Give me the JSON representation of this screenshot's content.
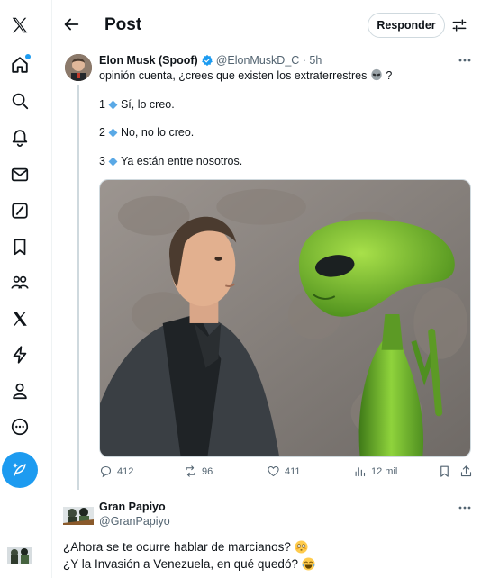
{
  "header": {
    "title": "Post",
    "reply_button": "Responder"
  },
  "nav": {
    "items": [
      "x-logo-icon",
      "home-icon",
      "search-icon",
      "notifications-icon",
      "messages-icon",
      "grok-icon",
      "bookmarks-icon",
      "communities-icon",
      "premium-icon",
      "verified-orgs-icon",
      "profile-icon",
      "more-icon"
    ],
    "compose": "compose-icon"
  },
  "tweet": {
    "author_name": "Elon Musk (Spoof)",
    "author_handle": "@ElonMuskD_C",
    "time": "5h",
    "text": "opinión cuenta, ¿crees que existen los extraterrestres",
    "text_end": "?",
    "poll": [
      {
        "number": "1",
        "label": "Sí, lo creo."
      },
      {
        "number": "2",
        "label": "No, no lo creo."
      },
      {
        "number": "3",
        "label": "Ya están entre nosotros."
      }
    ],
    "stats": {
      "replies": "412",
      "reposts": "96",
      "likes": "411",
      "views": "12 mil"
    }
  },
  "reply": {
    "author_name": "Gran Papiyo",
    "author_handle": "@GranPapiyo",
    "line1": "¿Ahora se te ocurre hablar de marcianos?",
    "line2": "¿Y la Invasión a Venezuela, en qué quedó?"
  },
  "colors": {
    "accent": "#1d9bf0",
    "text": "#0f1419",
    "secondary": "#536471",
    "border": "#eff3f4"
  }
}
